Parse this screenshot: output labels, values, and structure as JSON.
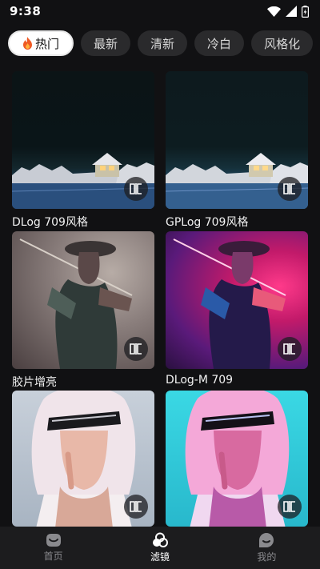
{
  "status": {
    "time": "9:38"
  },
  "tabs": [
    {
      "label": "热门",
      "active": true,
      "icon": "fire-icon"
    },
    {
      "label": "最新"
    },
    {
      "label": "清新"
    },
    {
      "label": "冷白"
    },
    {
      "label": "风格化"
    }
  ],
  "filters": [
    {
      "name": "DLog 709风格"
    },
    {
      "name": "GPLog 709风格"
    },
    {
      "name": "胶片增亮"
    },
    {
      "name": "DLog-M 709"
    },
    {
      "name": ""
    },
    {
      "name": ""
    }
  ],
  "nav": {
    "home": "首页",
    "filters": "滤镜",
    "mine": "我的",
    "active": "filters"
  }
}
